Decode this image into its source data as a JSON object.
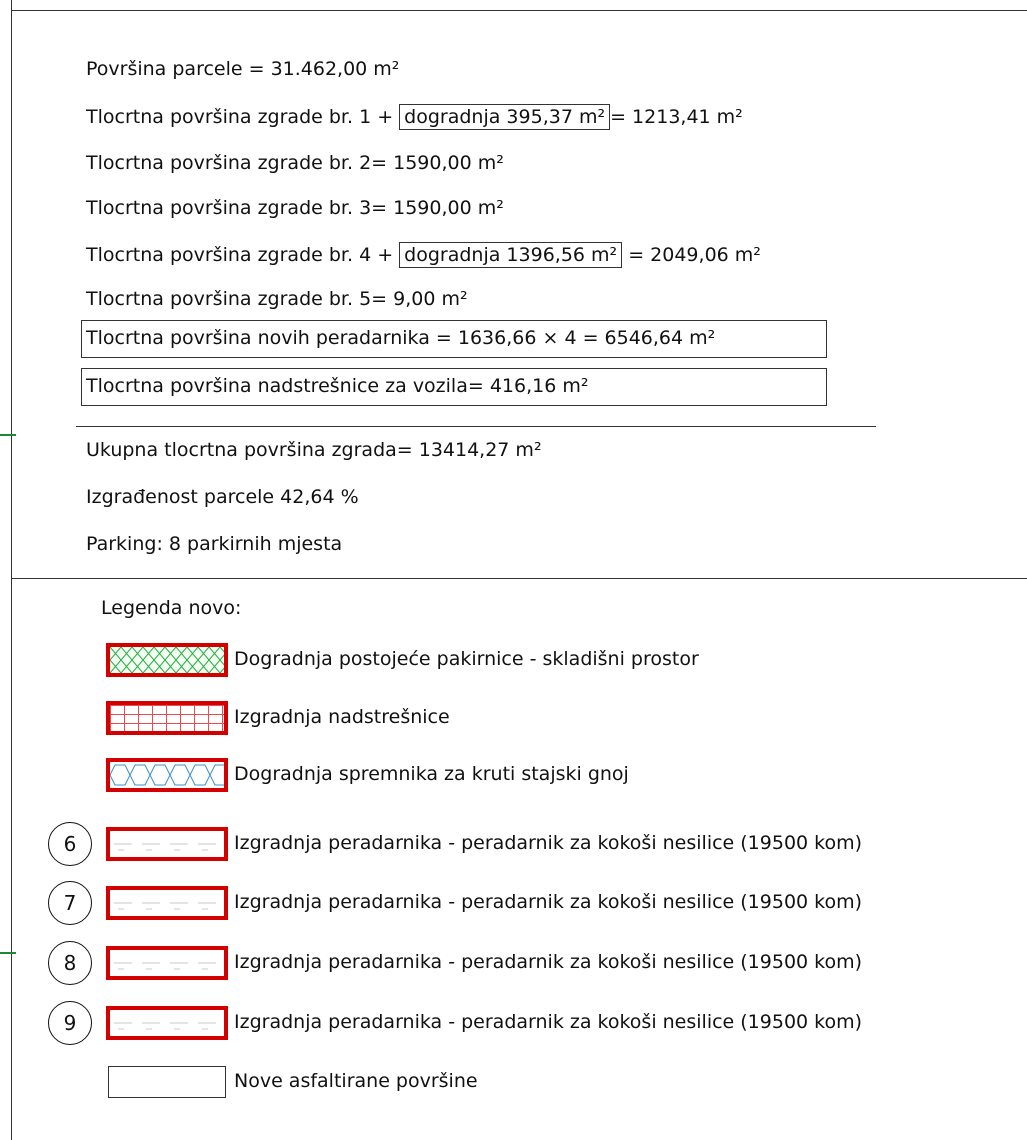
{
  "summary": {
    "parcel": "Površina parcele = 31.462,00 m²",
    "b1_pre": "Tlocrtna površina zgrade br. 1 + ",
    "b1_box": "dogradnja 395,37 m²",
    "b1_post": "= 1213,41 m²",
    "b2": "Tlocrtna površina zgrade br. 2= 1590,00 m²",
    "b3": "Tlocrtna površina zgrade br. 3= 1590,00 m²",
    "b4_pre": "Tlocrtna površina zgrade br. 4 + ",
    "b4_box": "dogradnja 1396,56 m²",
    "b4_post": " = 2049,06 m²",
    "b5": "Tlocrtna površina zgrade br. 5= 9,00 m²",
    "poultry": "Tlocrtna površina novih peradarnika = 1636,66 × 4 = 6546,64 m²",
    "canopy": "Tlocrtna površina nadstrešnice za vozila= 416,16 m²",
    "total": "Ukupna tlocrtna površina zgrada= 13414,27 m²",
    "builtup": "Izgrađenost parcele 42,64 %",
    "parking": "Parking: 8 parkirnih mjesta"
  },
  "legend": {
    "title": "Legenda novo:",
    "items": [
      {
        "label": "Dogradnja postojeće pakirnice - skladišni prostor",
        "pattern": "green-crosshatch"
      },
      {
        "label": "Izgradnja nadstrešnice",
        "pattern": "red-grid"
      },
      {
        "label": "Dogradnja spremnika za kruti stajski gnoj",
        "pattern": "blue-hexagon"
      },
      {
        "number": "6",
        "label": "Izgradnja peradarnika - peradarnik za kokoši nesilice (19500 kom)",
        "pattern": "grey-dash"
      },
      {
        "number": "7",
        "label": "Izgradnja peradarnika - peradarnik za kokoši nesilice (19500 kom)",
        "pattern": "grey-dash"
      },
      {
        "number": "8",
        "label": "Izgradnja peradarnika - peradarnik za kokoši nesilice (19500 kom)",
        "pattern": "grey-dash"
      },
      {
        "number": "9",
        "label": "Izgradnja peradarnika - peradarnik za kokoši nesilice (19500 kom)",
        "pattern": "grey-dash"
      },
      {
        "label": "Nove asfaltirane površine",
        "pattern": "plain"
      }
    ]
  },
  "colors": {
    "swatch_border": "#d40000",
    "green": "#1faa3a",
    "blue": "#3a8fd0",
    "marker": "#1a8a3a"
  }
}
